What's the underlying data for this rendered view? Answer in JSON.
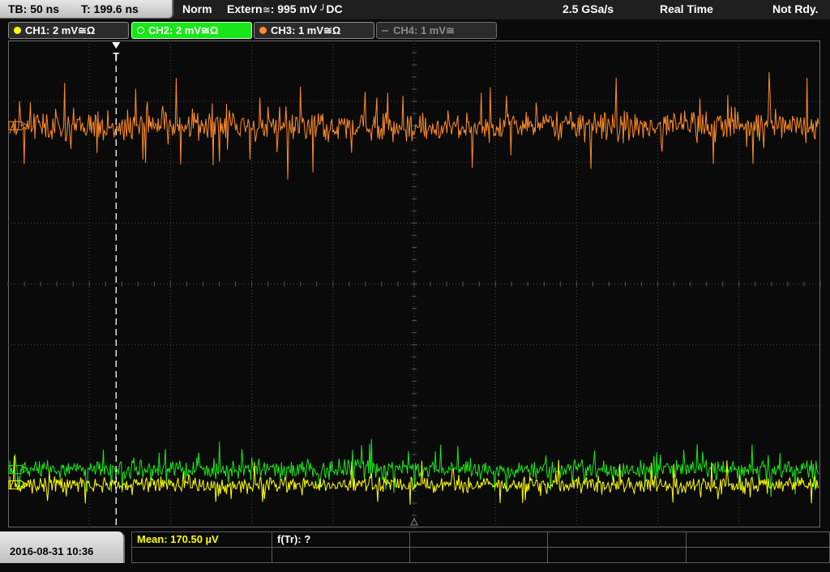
{
  "status": {
    "timebase": "TB: 50 ns",
    "trigger_time": "T: 199.6 ns",
    "trigger_mode": "Norm",
    "trigger_source": "Extern",
    "trigger_coupling_symbol": "≅",
    "trigger_level": ": 995 mV",
    "trigger_slope_symbol": "⎍",
    "trigger_slope_coupling": "DC",
    "sample_rate": "2.5 GSa/s",
    "acq_mode": "Real Time",
    "acq_state": "Not Rdy."
  },
  "channels": [
    {
      "label": "CH1: 2 mV≅Ω",
      "color": "#ffff00",
      "state": "on"
    },
    {
      "label": "CH2: 2 mV≅Ω",
      "color": "#19e619",
      "state": "selected"
    },
    {
      "label": "CH3: 1 mV≅Ω",
      "color": "#ff8c28",
      "state": "on"
    },
    {
      "label": "CH4: 1 mV≅",
      "color": "#6e6e6e",
      "state": "off"
    }
  ],
  "trigger_marker": "T",
  "footer": {
    "datetime": "2016-08-31 10:36",
    "measurement_1": "Mean: 170.50 µV",
    "measurement_1_color": "#ffff00",
    "measurement_2": "f(Tr): ?"
  },
  "colors": {
    "ch1": "#ffff00",
    "ch2": "#19e619",
    "ch3": "#ff8c28",
    "grid": "#4a4a4a",
    "background": "#0a0a0a"
  },
  "chart_data": {
    "type": "line",
    "grid": true,
    "x_divisions": 10,
    "y_divisions": 8,
    "series": [
      {
        "name": "CH3",
        "color": "#ff8c28",
        "center_div": 1.4,
        "noise_div": 0.45
      },
      {
        "name": "CH2",
        "color": "#19e619",
        "center_div": 7.05,
        "noise_div": 0.28
      },
      {
        "name": "CH1",
        "color": "#ffff00",
        "center_div": 7.3,
        "noise_div": 0.25
      }
    ],
    "trigger_position_div": 1.33
  }
}
